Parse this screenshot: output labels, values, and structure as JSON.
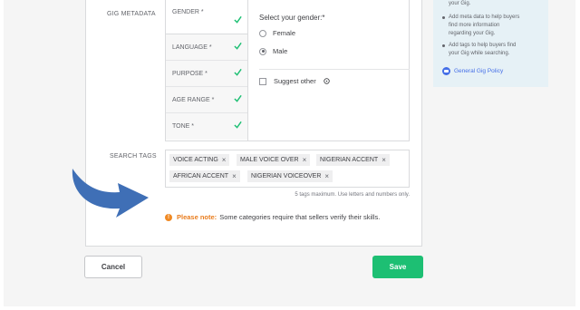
{
  "sections": {
    "gig_metadata_label": "GIG METADATA",
    "search_tags_label": "SEARCH TAGS"
  },
  "metadata": {
    "items": [
      {
        "label": "GENDER *",
        "checked": true
      },
      {
        "label": "LANGUAGE *",
        "checked": true
      },
      {
        "label": "PURPOSE *",
        "checked": true
      },
      {
        "label": "AGE RANGE *",
        "checked": true
      },
      {
        "label": "TONE *",
        "checked": true
      }
    ],
    "gender_prompt": "Select your gender:*",
    "options": [
      "Female",
      "Male"
    ],
    "selected_option": "Male",
    "suggest_other": "Suggest other"
  },
  "tags": [
    "VOICE ACTING",
    "MALE VOICE OVER",
    "NIGERIAN ACCENT",
    "AFRICAN ACCENT",
    "NIGERIAN VOICEOVER"
  ],
  "tags_hint": "5 tags maximum. Use letters and numbers only.",
  "note": {
    "label": "Please note:",
    "text": "Some categories require that sellers verify their skills."
  },
  "side_panel": {
    "lines": [
      "your Gig.",
      "Add meta data to help buyers",
      "find more information",
      "regarding your Gig.",
      "Add tags to help buyers find",
      "your Gig while searching."
    ],
    "policy_link": "General Gig Policy"
  },
  "buttons": {
    "cancel": "Cancel",
    "save": "Save"
  },
  "colors": {
    "accent_green": "#1dbf73",
    "check_green": "#1dbf73",
    "note_orange": "#e97d1e",
    "arrow_blue": "#3f6fb6",
    "side_panel_bg": "#e6f1f6"
  }
}
